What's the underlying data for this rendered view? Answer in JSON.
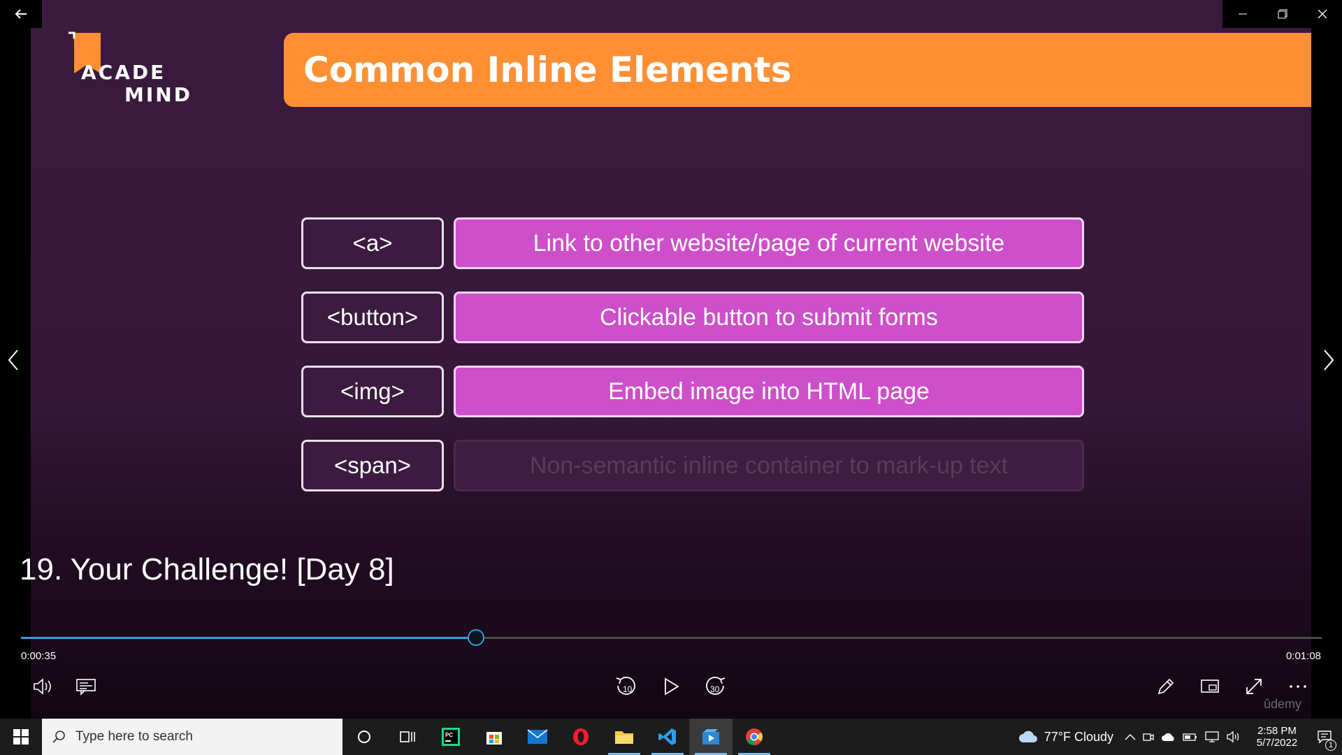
{
  "slide": {
    "logo_line1": "ACADE",
    "logo_line2": "MIND",
    "title": "Common Inline Elements",
    "rows": [
      {
        "tag": "<a>",
        "desc": "Link to other website/page of current website"
      },
      {
        "tag": "<button>",
        "desc": "Clickable button to submit forms"
      },
      {
        "tag": "<img>",
        "desc": "Embed image into HTML page"
      },
      {
        "tag": "<span>",
        "desc": "Non-semantic inline container to mark-up text"
      }
    ]
  },
  "player": {
    "caption": "19. Your Challenge! [Day 8]",
    "elapsed": "0:00:35",
    "duration": "0:01:08",
    "progress": 0.35,
    "skip_back_seconds": "10",
    "skip_forward_seconds": "30",
    "watermark": "ûdemy"
  },
  "taskbar": {
    "search_placeholder": "Type here to search",
    "weather": "77°F  Cloudy",
    "time": "2:58 PM",
    "date": "5/7/2022",
    "notification_count": "1"
  },
  "colors": {
    "accent_orange": "#ff8f33",
    "desc_pink": "#cd4fc9",
    "progress_blue": "#3a9ad9"
  }
}
